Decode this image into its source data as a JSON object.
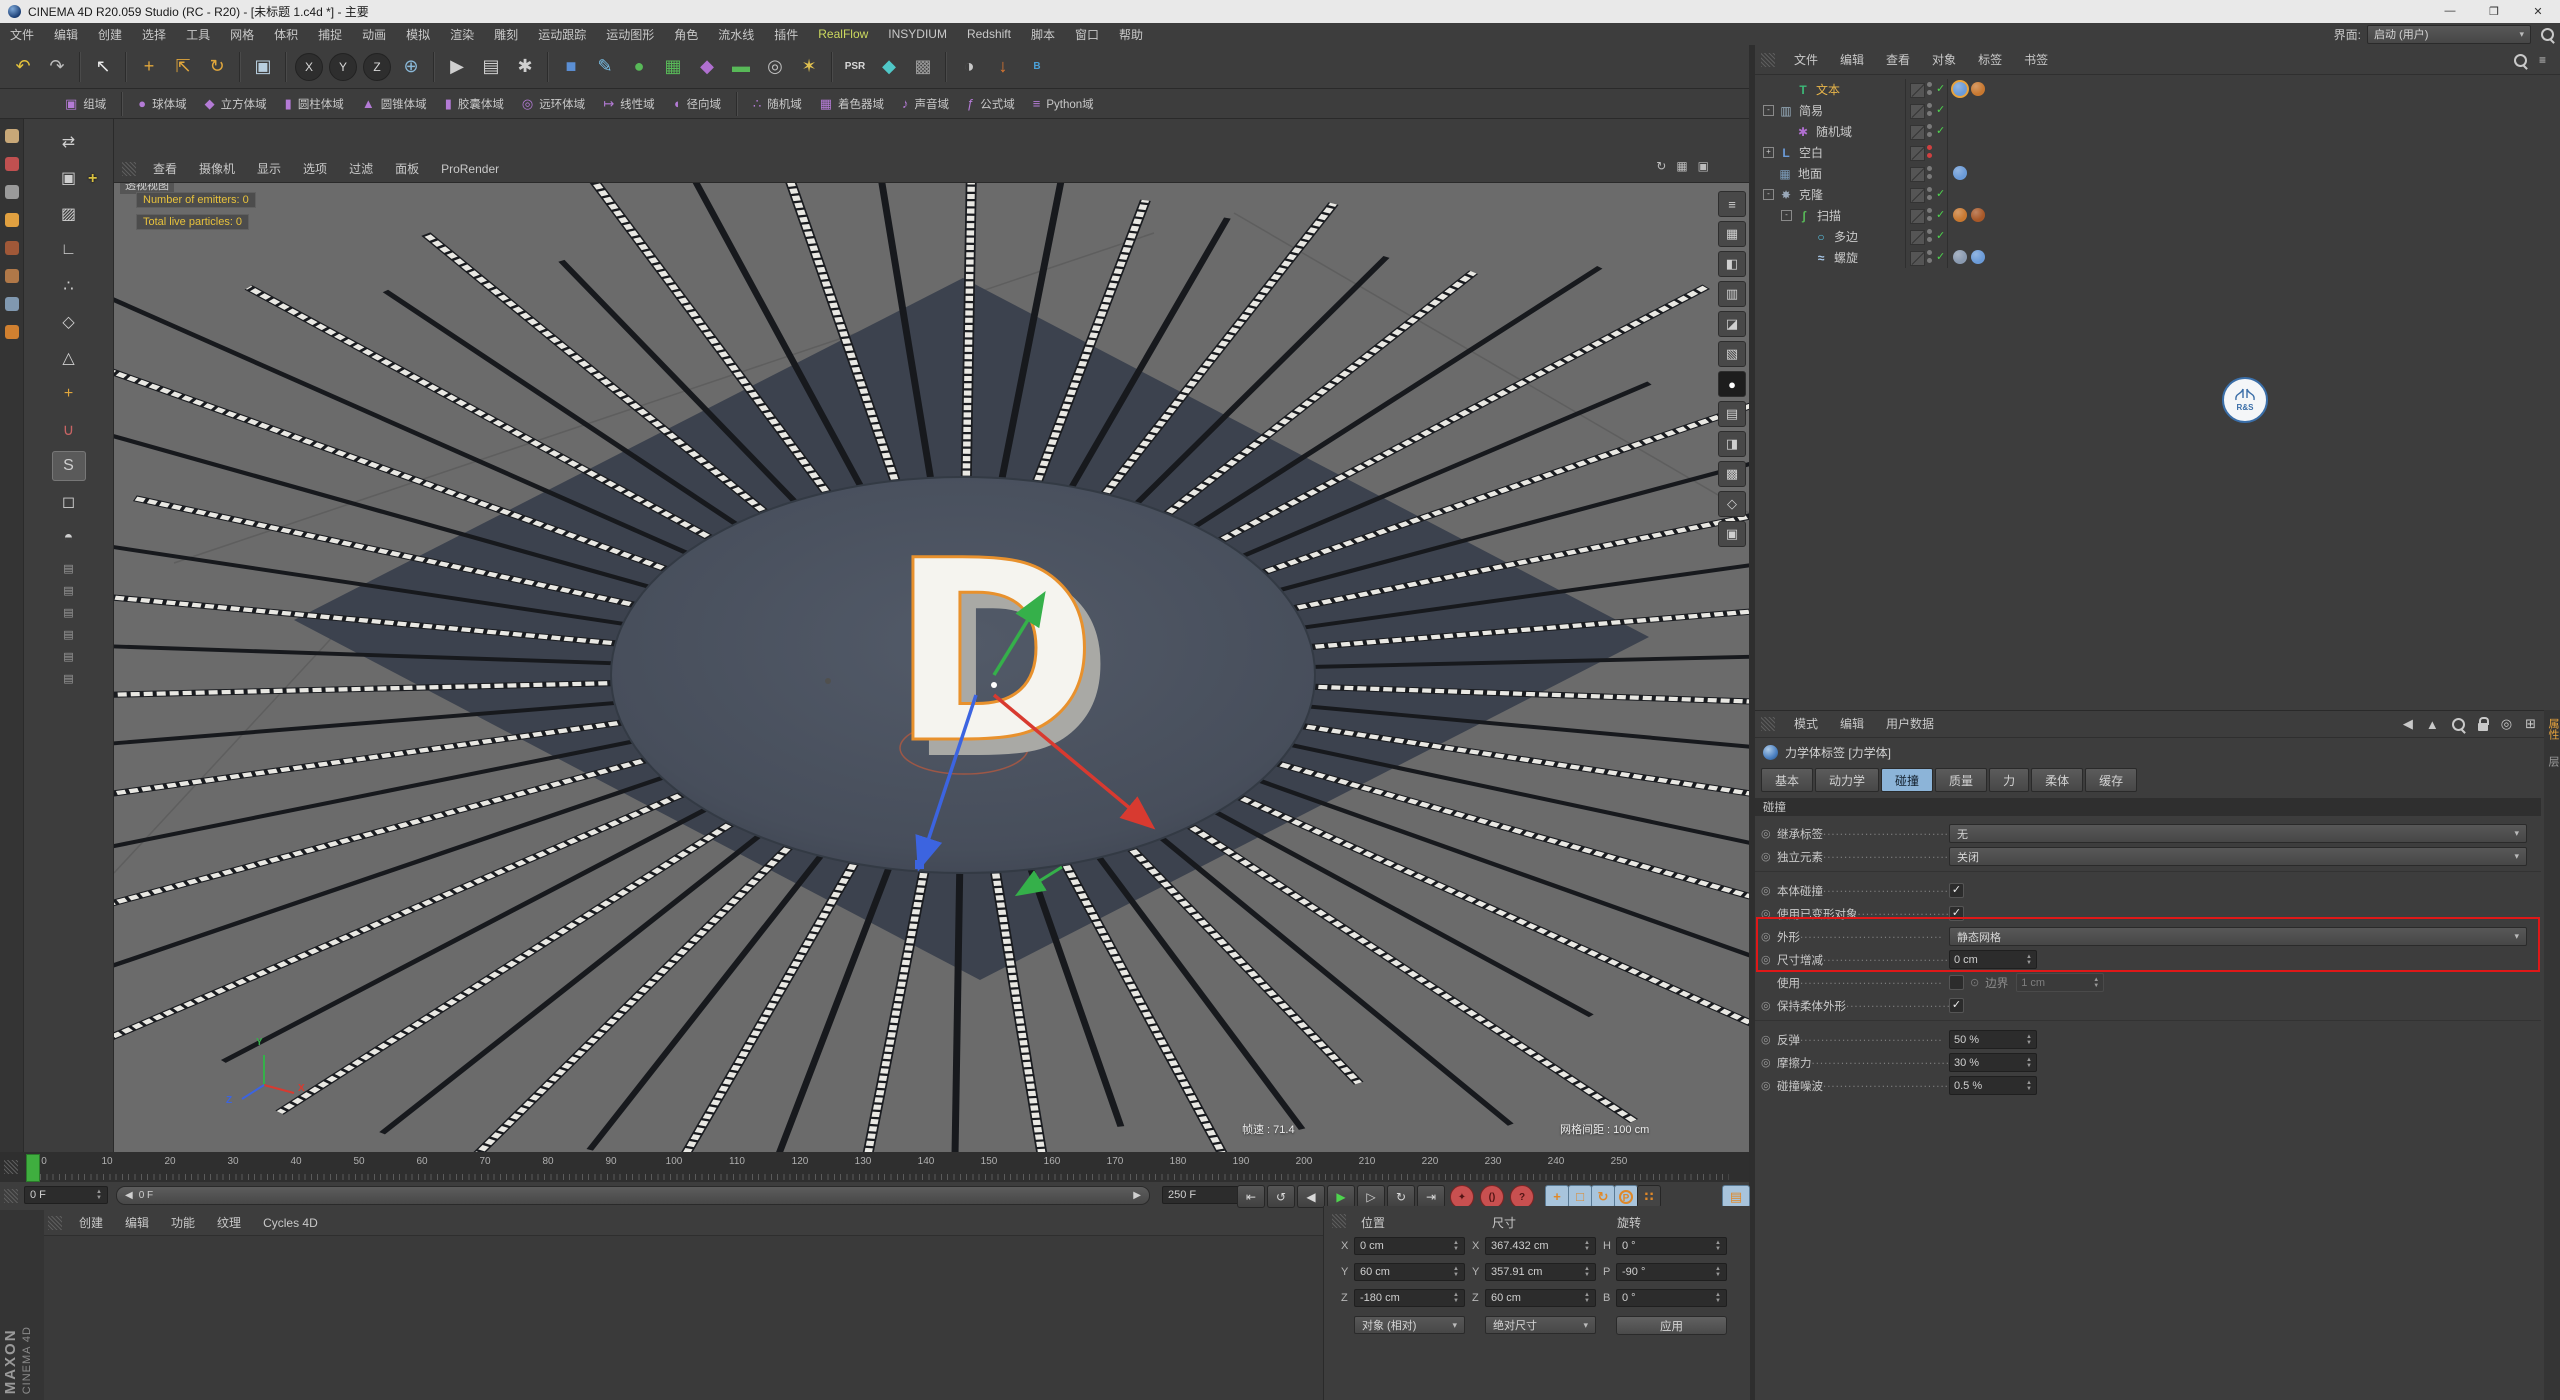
{
  "window": {
    "title": "CINEMA 4D R20.059 Studio (RC - R20) - [未标题 1.c4d *] - 主要",
    "minimize": "—",
    "maximize": "❐",
    "close": "✕"
  },
  "menubar": {
    "items": [
      "文件",
      "编辑",
      "创建",
      "选择",
      "工具",
      "网格",
      "体积",
      "捕捉",
      "动画",
      "模拟",
      "渲染",
      "雕刻",
      "运动跟踪",
      "运动图形",
      "角色",
      "流水线",
      "插件",
      "RealFlow",
      "INSYDIUM",
      "Redshift",
      "脚本",
      "窗口",
      "帮助"
    ],
    "interface_label": "界面:",
    "interface_value": "启动 (用户)"
  },
  "main_toolbar": {
    "icons": [
      {
        "name": "undo-icon",
        "glyph": "↶",
        "color": "#e3c23c"
      },
      {
        "name": "redo-icon",
        "glyph": "↷",
        "color": "#bdbdbd"
      },
      {
        "sep": true
      },
      {
        "name": "live-selection-icon",
        "glyph": "↖",
        "color": "#e8e8e8"
      },
      {
        "sep": true
      },
      {
        "name": "move-tool-icon",
        "glyph": "+",
        "color": "#e0a63c"
      },
      {
        "name": "scale-tool-icon",
        "glyph": "⇱",
        "color": "#e0a63c"
      },
      {
        "name": "rotate-tool-icon",
        "glyph": "↻",
        "color": "#e0a63c"
      },
      {
        "sep": true
      },
      {
        "name": "last-tool-icon",
        "glyph": "▣",
        "color": "#b8cfe0"
      },
      {
        "sep": true
      },
      {
        "name": "lock-x-icon",
        "glyph": "X",
        "color": "#d8d8d8",
        "circle": true
      },
      {
        "name": "lock-y-icon",
        "glyph": "Y",
        "color": "#d8d8d8",
        "circle": true
      },
      {
        "name": "lock-z-icon",
        "glyph": "Z",
        "color": "#d8d8d8",
        "circle": true
      },
      {
        "name": "coord-system-icon",
        "glyph": "⊕",
        "color": "#8ab8d8"
      },
      {
        "sep": true
      },
      {
        "name": "render-view-icon",
        "glyph": "▶",
        "color": "#cfcfcf"
      },
      {
        "name": "render-picture-viewer-icon",
        "glyph": "▤",
        "color": "#cfcfcf"
      },
      {
        "name": "render-settings-icon",
        "glyph": "✱",
        "color": "#cfcfcf"
      },
      {
        "sep": true
      },
      {
        "name": "primitive-cube-icon",
        "glyph": "■",
        "color": "#5b8fd4"
      },
      {
        "name": "pen-spline-icon",
        "glyph": "✎",
        "color": "#7ac0e8"
      },
      {
        "name": "subdivision-surface-icon",
        "glyph": "●",
        "color": "#58b958"
      },
      {
        "name": "array-generator-icon",
        "glyph": "▦",
        "color": "#58b958"
      },
      {
        "name": "deformer-icon",
        "glyph": "◆",
        "color": "#b070d0"
      },
      {
        "name": "environment-icon",
        "glyph": "▬",
        "color": "#58b958"
      },
      {
        "name": "camera-icon",
        "glyph": "◎",
        "color": "#bdbdbd"
      },
      {
        "name": "light-icon",
        "glyph": "✶",
        "color": "#e0c050"
      },
      {
        "sep": true
      },
      {
        "name": "psr-icon",
        "glyph": "PSR",
        "color": "#d8d8d8",
        "small": true
      },
      {
        "name": "mograph-icon",
        "glyph": "◆",
        "color": "#50c8c8"
      },
      {
        "name": "volume-icon",
        "glyph": "▩",
        "color": "#9a9a9a"
      },
      {
        "sep": true
      },
      {
        "name": "plugin-q-icon",
        "glyph": "◑",
        "color": "#c8c8c8"
      },
      {
        "name": "plugin-download-icon",
        "glyph": "↓",
        "color": "#e07830"
      },
      {
        "name": "plugin-b-icon",
        "glyph": "B",
        "color": "#4aa0d8",
        "small": true
      }
    ]
  },
  "fields_toolbar": {
    "items": [
      {
        "label": "组域",
        "glyph": "▣"
      },
      {
        "sep": true
      },
      {
        "label": "球体域",
        "glyph": "●"
      },
      {
        "label": "立方体域",
        "glyph": "◆"
      },
      {
        "label": "圆柱体域",
        "glyph": "▮"
      },
      {
        "label": "圆锥体域",
        "glyph": "▲"
      },
      {
        "label": "胶囊体域",
        "glyph": "▮"
      },
      {
        "label": "远环体域",
        "glyph": "◎"
      },
      {
        "label": "线性域",
        "glyph": "↦"
      },
      {
        "label": "径向域",
        "glyph": "◖"
      },
      {
        "sep": true
      },
      {
        "label": "随机域",
        "glyph": "∴"
      },
      {
        "label": "着色器域",
        "glyph": "▦"
      },
      {
        "label": "声音域",
        "glyph": "♪"
      },
      {
        "label": "公式域",
        "glyph": "ƒ"
      },
      {
        "label": "Python域",
        "glyph": "≡"
      }
    ]
  },
  "left_dock": {
    "icons": [
      {
        "name": "dock-icon-1",
        "color": "#c8a878"
      },
      {
        "name": "dock-icon-2",
        "color": "#c05050"
      },
      {
        "name": "dock-icon-3",
        "color": "#9a9a9a"
      },
      {
        "name": "dock-icon-4",
        "color": "#e0a040"
      },
      {
        "name": "dock-icon-5",
        "color": "#a05838"
      },
      {
        "name": "dock-icon-6",
        "color": "#b07848"
      },
      {
        "name": "dock-icon-7",
        "color": "#8098b0"
      },
      {
        "name": "dock-icon-8",
        "color": "#d08030"
      }
    ]
  },
  "left_toolbar": {
    "icons": [
      {
        "name": "make-editable-icon",
        "glyph": "⇄"
      },
      {
        "name": "model-mode-icon",
        "glyph": "▣"
      },
      {
        "name": "texture-mode-icon",
        "glyph": "▨"
      },
      {
        "name": "workplane-mode-icon",
        "glyph": "∟"
      },
      {
        "name": "points-mode-icon",
        "glyph": "∴"
      },
      {
        "name": "edges-mode-icon",
        "glyph": "◇"
      },
      {
        "name": "polygons-mode-icon",
        "glyph": "△"
      },
      {
        "name": "enable-axis-icon",
        "glyph": "+",
        "color": "#e0a63c"
      },
      {
        "name": "snap-icon",
        "glyph": "∪",
        "color": "#c86464"
      },
      {
        "name": "viewport-solo-icon",
        "glyph": "S",
        "active": true
      },
      {
        "name": "lock-icon",
        "glyph": "◻"
      },
      {
        "name": "sculpt-icon",
        "glyph": "◓"
      },
      {
        "name": "command-icon-1",
        "glyph": "▤",
        "mini": true
      },
      {
        "name": "command-icon-2",
        "glyph": "▤",
        "mini": true
      },
      {
        "name": "command-icon-3",
        "glyph": "▤",
        "mini": true
      },
      {
        "name": "command-icon-4",
        "glyph": "▤",
        "mini": true
      },
      {
        "name": "command-icon-5",
        "glyph": "▤",
        "mini": true
      },
      {
        "name": "command-icon-6",
        "glyph": "▤",
        "mini": true
      }
    ]
  },
  "viewport": {
    "menus": [
      "查看",
      "摄像机",
      "显示",
      "选项",
      "过滤",
      "面板",
      "ProRender"
    ],
    "corner_icons": [
      {
        "name": "viewport-sync-icon",
        "glyph": "↻"
      },
      {
        "name": "viewport-layout-icon",
        "glyph": "▦"
      },
      {
        "name": "viewport-maximize-icon",
        "glyph": "▣"
      }
    ],
    "side_icons": [
      {
        "name": "view-side-icon-1",
        "glyph": "≡"
      },
      {
        "name": "view-side-icon-2",
        "glyph": "▦"
      },
      {
        "name": "view-side-icon-3",
        "glyph": "◧"
      },
      {
        "name": "view-side-icon-4",
        "glyph": "▥"
      },
      {
        "name": "view-side-icon-5",
        "glyph": "◪"
      },
      {
        "name": "view-side-icon-6",
        "glyph": "▧"
      },
      {
        "name": "view-side-icon-7",
        "glyph": "●",
        "active": true
      },
      {
        "name": "view-side-icon-8",
        "glyph": "▤"
      },
      {
        "name": "view-side-icon-9",
        "glyph": "◨"
      },
      {
        "name": "view-side-icon-10",
        "glyph": "▩"
      },
      {
        "name": "view-side-icon-11",
        "glyph": "◇"
      },
      {
        "name": "view-side-icon-12",
        "glyph": "▣"
      }
    ],
    "view_label": "透视视图",
    "tooltips": [
      "Number of emitters: 0",
      "Total live particles: 0"
    ],
    "letter": "D",
    "fps": "帧速 : 71.4",
    "grid": "网格间距 : 100 cm",
    "axis_labels": [
      "X",
      "Y",
      "Z"
    ]
  },
  "object_manager": {
    "menus": [
      "文件",
      "编辑",
      "查看",
      "对象",
      "标签",
      "书签"
    ],
    "items": [
      {
        "label": "文本",
        "level": 1,
        "icon_glyph": "T",
        "icon_color": "#3cb878",
        "vis": "gray",
        "check": true,
        "selected": true,
        "tags": [
          {
            "color": "#6b9bd8",
            "ring": true
          },
          {
            "color": "#c87830"
          }
        ]
      },
      {
        "label": "简易",
        "level": 0,
        "expander": "-",
        "icon_glyph": "▥",
        "icon_color": "#9ab0c0",
        "vis": "gray",
        "check": true,
        "tags": []
      },
      {
        "label": "随机域",
        "level": 1,
        "icon_glyph": "✱",
        "icon_color": "#b06fd0",
        "vis": "gray",
        "check": true,
        "tags": []
      },
      {
        "label": "空白",
        "level": 0,
        "expander": "+",
        "icon_glyph": "L",
        "icon_color": "#6b9bd8",
        "vis": "red",
        "check": false,
        "tags": []
      },
      {
        "label": "地面",
        "level": 0,
        "icon_glyph": "▦",
        "icon_color": "#7a9ab8",
        "vis": "gray",
        "check": false,
        "tags": [
          {
            "color": "#6b9bd8"
          }
        ]
      },
      {
        "label": "克隆",
        "level": 0,
        "expander": "-",
        "icon_glyph": "✸",
        "icon_color": "#9aa8b8",
        "vis": "gray",
        "check": true,
        "tags": []
      },
      {
        "label": "扫描",
        "level": 1,
        "expander": "-",
        "icon_glyph": "ʃ",
        "icon_color": "#58b958",
        "vis": "gray",
        "check": true,
        "tags": [
          {
            "color": "#c87830"
          },
          {
            "color": "#a85828"
          }
        ]
      },
      {
        "label": "多边",
        "level": 2,
        "icon_glyph": "○",
        "icon_color": "#58c8e8",
        "vis": "gray",
        "check": true,
        "tags": []
      },
      {
        "label": "螺旋",
        "level": 2,
        "icon_glyph": "≈",
        "icon_color": "#a8c8e8",
        "vis": "gray",
        "check": true,
        "tags": [
          {
            "color": "#8a9ab0"
          },
          {
            "color": "#6b9bd8"
          }
        ]
      }
    ]
  },
  "watermark": {
    "label": "R&S"
  },
  "attribute_manager": {
    "menus": [
      "模式",
      "编辑",
      "用户数据"
    ],
    "title": "力学体标签 [力学体]",
    "tabs": [
      {
        "label": "基本"
      },
      {
        "label": "动力学"
      },
      {
        "label": "碰撞",
        "active": true
      },
      {
        "label": "质量"
      },
      {
        "label": "力"
      },
      {
        "label": "柔体"
      },
      {
        "label": "缓存"
      }
    ],
    "section": "碰撞",
    "rows": [
      {
        "label": "继承标签",
        "widget": "dropdown",
        "value": "无"
      },
      {
        "label": "独立元素",
        "widget": "dropdown",
        "value": "关闭"
      },
      {
        "label": "本体碰撞",
        "widget": "check",
        "checked": true,
        "sep_before": true
      },
      {
        "label": "使用已变形对象",
        "widget": "check",
        "checked": true
      },
      {
        "label": "外形",
        "widget": "dropdown",
        "value": "静态网格"
      },
      {
        "label": "尺寸增减",
        "widget": "spinner",
        "value": "0 cm"
      },
      {
        "label": "使用",
        "widget": "check_extra",
        "checked": false,
        "extra_label": "边界",
        "extra_value": "1 cm",
        "no_dot": true
      },
      {
        "label": "保持柔体外形",
        "widget": "check",
        "checked": true
      },
      {
        "label": "反弹",
        "widget": "spinner",
        "value": "50 %",
        "sep_before": true
      },
      {
        "label": "摩擦力",
        "widget": "spinner",
        "value": "30 %"
      },
      {
        "label": "碰撞噪波",
        "widget": "spinner",
        "value": "0.5 %"
      }
    ],
    "side_tabs": [
      {
        "label": "属性",
        "active": true
      },
      {
        "label": "层"
      }
    ]
  },
  "timeline": {
    "start": 0,
    "end": 250,
    "step": 10,
    "current": "0 F",
    "slider_label": "0 F",
    "slider_arrow_left": "◀",
    "slider_arrow_right": "▶",
    "end_frame": "250 F"
  },
  "transport": {
    "nav": [
      {
        "name": "goto-start-button",
        "glyph": "⇤"
      },
      {
        "name": "prev-key-button",
        "glyph": "↺"
      },
      {
        "name": "prev-frame-button",
        "glyph": "◀"
      },
      {
        "name": "play-button",
        "glyph": "▶",
        "color": "#4ed44e"
      },
      {
        "name": "next-frame-button",
        "glyph": "▷"
      },
      {
        "name": "next-key-button",
        "glyph": "↻"
      },
      {
        "name": "goto-end-button",
        "glyph": "⇥"
      }
    ],
    "record": [
      {
        "name": "record-keyframe-button",
        "glyph": "✦"
      },
      {
        "name": "autokey-button",
        "glyph": "()"
      },
      {
        "name": "keyframe-selection-help-button",
        "glyph": "?"
      }
    ],
    "keying": [
      {
        "name": "key-position-button",
        "glyph": "+"
      },
      {
        "name": "key-scale-button",
        "glyph": "□"
      },
      {
        "name": "key-rotation-button",
        "glyph": "↻"
      },
      {
        "name": "key-parameter-button",
        "glyph": "P",
        "circle": true
      },
      {
        "name": "key-pla-button",
        "glyph": "∷",
        "dark": true
      }
    ],
    "film": {
      "name": "keyframe-film-button",
      "glyph": "▤"
    }
  },
  "material_manager": {
    "tabs": [
      "创建",
      "编辑",
      "功能",
      "纹理",
      "Cycles 4D"
    ],
    "brand1": "MAXON",
    "brand2": "CINEMA 4D"
  },
  "coordinates": {
    "titles": [
      "位置",
      "尺寸",
      "旋转"
    ],
    "pos_axes": [
      "X",
      "Y",
      "Z"
    ],
    "pos_values": [
      "0 cm",
      "60 cm",
      "-180 cm"
    ],
    "size_axes": [
      "X",
      "Y",
      "Z"
    ],
    "size_values": [
      "367.432 cm",
      "357.91 cm",
      "60 cm"
    ],
    "rot_axes": [
      "H",
      "P",
      "B"
    ],
    "rot_values": [
      "0 °",
      "-90 °",
      "0 °"
    ],
    "pos_mode": "对象 (相对)",
    "size_mode": "绝对尺寸",
    "apply_label": "应用"
  }
}
